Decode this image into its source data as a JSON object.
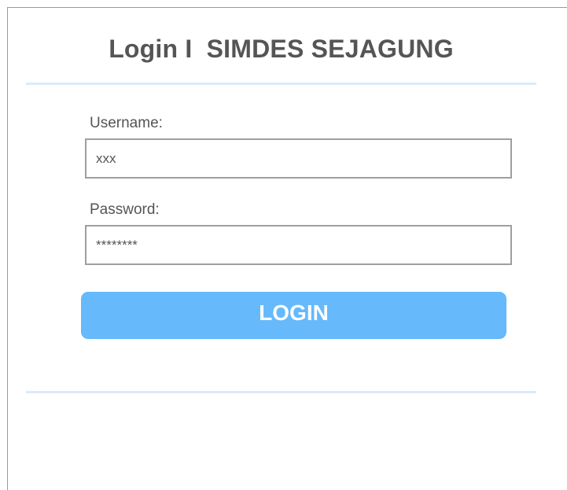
{
  "form": {
    "title": "Login I  SIMDES SEJAGUNG",
    "username_label": "Username:",
    "username_value": "xxx",
    "password_label": "Password:",
    "password_value": "********",
    "login_label": "LOGIN"
  },
  "colors": {
    "accent": "#66b9fb",
    "divider": "#dbeafb",
    "text": "#555555",
    "border": "#9f9f9f"
  }
}
